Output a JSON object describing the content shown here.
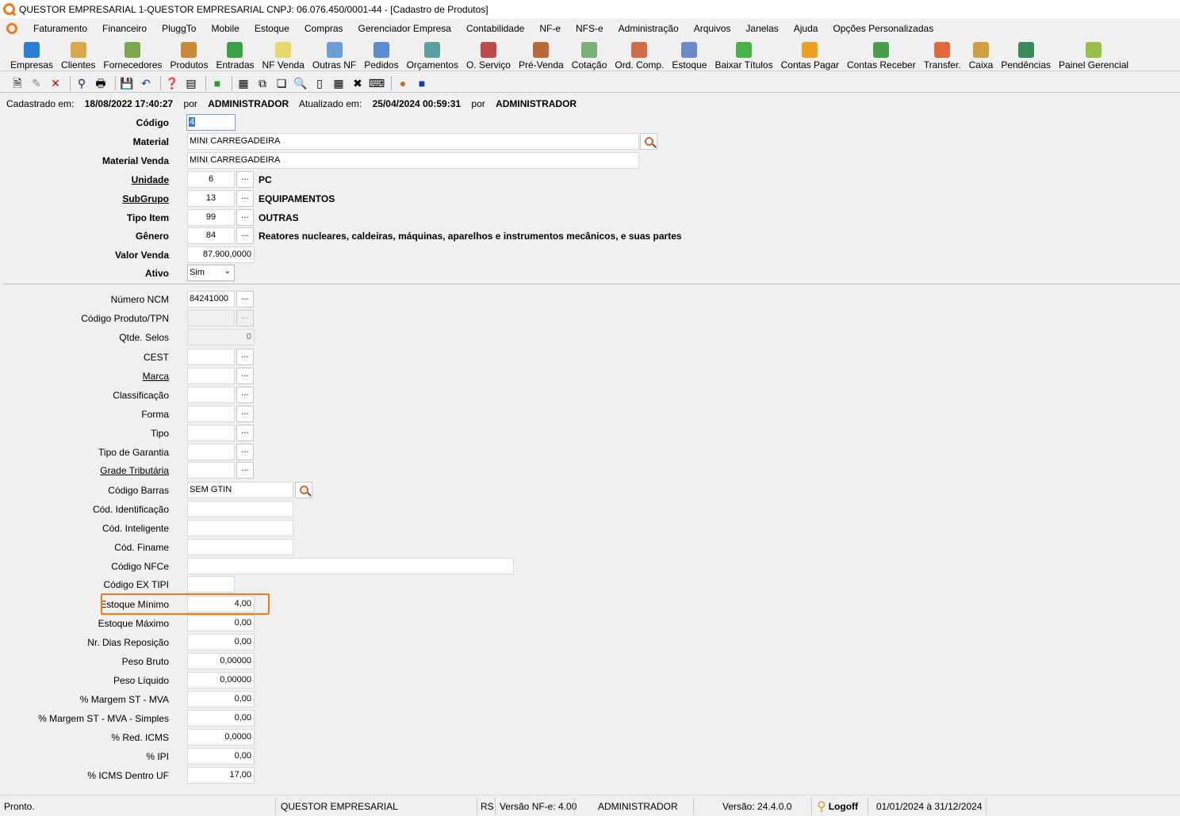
{
  "window": {
    "title": "QUESTOR EMPRESARIAL 1-QUESTOR EMPRESARIAL CNPJ: 06.076.450/0001-44 - [Cadastro de Produtos]"
  },
  "menu": [
    "Faturamento",
    "Financeiro",
    "PluggTo",
    "Mobile",
    "Estoque",
    "Compras",
    "Gerenciador Empresa",
    "Contabilidade",
    "NF-e",
    "NFS-e",
    "Administração",
    "Arquivos",
    "Janelas",
    "Ajuda",
    "Opções Personalizadas"
  ],
  "toolbar": [
    {
      "label": "Empresas",
      "icon": "empresas-icon",
      "color": "#2a7fd4"
    },
    {
      "label": "Clientes",
      "icon": "clientes-icon",
      "color": "#d9a84a"
    },
    {
      "label": "Fornecedores",
      "icon": "fornecedores-icon",
      "color": "#7aa84a"
    },
    {
      "label": "Produtos",
      "icon": "produtos-icon",
      "color": "#c98a3a"
    },
    {
      "label": "Entradas",
      "icon": "entradas-icon",
      "color": "#3aa04a"
    },
    {
      "label": "NF Venda",
      "icon": "nf-venda-icon",
      "color": "#e8d86a"
    },
    {
      "label": "Outras NF",
      "icon": "outras-nf-icon",
      "color": "#6aa0d8"
    },
    {
      "label": "Pedidos",
      "icon": "pedidos-icon",
      "color": "#5a8ad0"
    },
    {
      "label": "Orçamentos",
      "icon": "orcamentos-icon",
      "color": "#5aa0a0"
    },
    {
      "label": "O. Serviço",
      "icon": "servico-icon",
      "color": "#c04a4a"
    },
    {
      "label": "Pré-Venda",
      "icon": "pre-venda-icon",
      "color": "#b86a3a"
    },
    {
      "label": "Cotação",
      "icon": "cotacao-icon",
      "color": "#7ab07a"
    },
    {
      "label": "Ord. Comp.",
      "icon": "ord-comp-icon",
      "color": "#d06a4a"
    },
    {
      "label": "Estoque",
      "icon": "estoque-icon",
      "color": "#6a8ac8"
    },
    {
      "label": "Baixar Títulos",
      "icon": "baixar-titulos-icon",
      "color": "#4ab04a"
    },
    {
      "label": "Contas Pagar",
      "icon": "contas-pagar-icon",
      "color": "#f0a020"
    },
    {
      "label": "Contas Receber",
      "icon": "contas-receber-icon",
      "color": "#4aa04a"
    },
    {
      "label": "Transfer.",
      "icon": "transfer-icon",
      "color": "#e06a3a"
    },
    {
      "label": "Caixa",
      "icon": "caixa-icon",
      "color": "#d0a040"
    },
    {
      "label": "Pendências",
      "icon": "pendencias-icon",
      "color": "#3a8a5a"
    },
    {
      "label": "Painel Gerencial",
      "icon": "painel-gerencial-icon",
      "color": "#9ac04a"
    }
  ],
  "info": {
    "cadastrado_label": "Cadastrado em:",
    "cadastrado_value": "18/08/2022 17:40:27",
    "por1": "por",
    "user1": "ADMINISTRADOR",
    "atualizado_label": "Atualizado em:",
    "atualizado_value": "25/04/2024 00:59:31",
    "por2": "por",
    "user2": "ADMINISTRADOR"
  },
  "form": {
    "codigo": {
      "label": "Código",
      "value": "4"
    },
    "material": {
      "label": "Material",
      "value": "MINI CARREGADEIRA"
    },
    "material_venda": {
      "label": "Material Venda",
      "value": "MINI CARREGADEIRA"
    },
    "unidade": {
      "label": "Unidade",
      "value": "6",
      "btn": "...",
      "desc": "PC"
    },
    "subgrupo": {
      "label": "SubGrupo",
      "value": "13",
      "btn": "...",
      "desc": "EQUIPAMENTOS"
    },
    "tipo_item": {
      "label": "Tipo Item",
      "value": "99",
      "btn": "...",
      "desc": "OUTRAS"
    },
    "genero": {
      "label": "Gênero",
      "value": "84",
      "btn": "...",
      "desc": "Reatores nucleares, caldeiras, máquinas, aparelhos e instrumentos mecânicos, e suas partes"
    },
    "valor_venda": {
      "label": "Valor Venda",
      "value": "87.900,0000"
    },
    "ativo": {
      "label": "Ativo",
      "value": "Sim"
    }
  },
  "details": {
    "numero_ncm": {
      "label": "Número NCM",
      "value": "84241000",
      "btn": "..."
    },
    "codigo_produto_tpn": {
      "label": "Código Produto/TPN",
      "value": "",
      "btn": "..."
    },
    "qtde_selos": {
      "label": "Qtde. Selos",
      "value": "0"
    },
    "cest": {
      "label": "CEST",
      "value": "",
      "btn": "..."
    },
    "marca": {
      "label": "Marca",
      "value": "",
      "btn": "..."
    },
    "classificacao": {
      "label": "Classificação",
      "value": "",
      "btn": "..."
    },
    "forma": {
      "label": "Forma",
      "value": "",
      "btn": "..."
    },
    "tipo": {
      "label": "Tipo",
      "value": "",
      "btn": "..."
    },
    "tipo_garantia": {
      "label": "Tipo de Garantia",
      "value": "",
      "btn": "..."
    },
    "grade_tributaria": {
      "label": "Grade Tributária",
      "value": "",
      "btn": "..."
    },
    "codigo_barras": {
      "label": "Código Barras",
      "value": "SEM GTIN"
    },
    "cod_identificacao": {
      "label": "Cód. Identificação",
      "value": ""
    },
    "cod_inteligente": {
      "label": "Cód. Inteligente",
      "value": ""
    },
    "cod_finame": {
      "label": "Cód. Finame",
      "value": ""
    },
    "codigo_nfce": {
      "label": "Código NFCe",
      "value": ""
    },
    "codigo_ex_tipi": {
      "label": "Código EX TIPI",
      "value": ""
    },
    "estoque_minimo": {
      "label": "Estoque Mínimo",
      "value": "4,00"
    },
    "estoque_maximo": {
      "label": "Estoque Máximo",
      "value": "0,00"
    },
    "nr_dias_reposicao": {
      "label": "Nr. Dias Reposição",
      "value": "0,00"
    },
    "peso_bruto": {
      "label": "Peso Bruto",
      "value": "0,00000"
    },
    "peso_liquido": {
      "label": "Peso Líquido",
      "value": "0,00000"
    },
    "margem_st_mva": {
      "label": "% Margem ST - MVA",
      "value": "0,00"
    },
    "margem_st_mva_simples": {
      "label": "% Margem ST - MVA - Simples",
      "value": "0,00"
    },
    "red_icms": {
      "label": "% Red. ICMS",
      "value": "0,0000"
    },
    "ipi": {
      "label": "% IPI",
      "value": "0,00"
    },
    "icms_dentro_uf": {
      "label": "% ICMS Dentro UF",
      "value": "17,00"
    }
  },
  "status": {
    "pronto": "Pronto.",
    "empresa": "QUESTOR EMPRESARIAL",
    "uf": "RS",
    "versao_nfe": "Versão NF-e: 4.00",
    "usuario": "ADMINISTRADOR",
    "versao": "Versão: 24.4.0.0",
    "logoff": "Logoff",
    "periodo": "01/01/2024 à 31/12/2024"
  },
  "colors": {
    "accent": "#f07b1a",
    "highlight_border": "#f07b1a"
  }
}
